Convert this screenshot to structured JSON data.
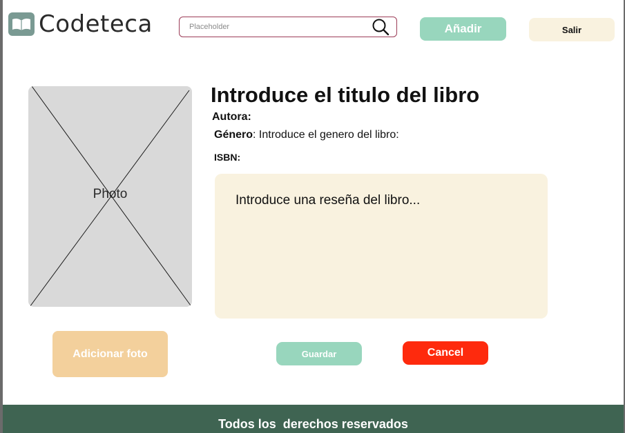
{
  "header": {
    "app_name": "Codeteca",
    "search": {
      "placeholder": "Placeholder",
      "value": "",
      "icon": "search-icon"
    },
    "add_label": "Añadir",
    "exit_label": "Salir"
  },
  "photo": {
    "label": "Photo",
    "add_photo_label": "Adicionar foto"
  },
  "book": {
    "title": "Introduce el titulo del libro",
    "author_label": "Autora:",
    "genre_label": "Género",
    "genre_value": ": Introduce el genero del libro:",
    "isbn_label": "ISBN:",
    "review_placeholder": "Introduce una reseña del libro..."
  },
  "actions": {
    "save_label": "Guardar",
    "cancel_label": "Cancel"
  },
  "footer": {
    "text": "Todos los  derechos reservados"
  },
  "colors": {
    "brand_green": "#98d6bd",
    "cream": "#f9f2df",
    "photo_button": "#f3d09c",
    "cancel_red": "#fe2a0d",
    "footer_green": "#3f6452",
    "logo_tile": "#7a9a93"
  }
}
